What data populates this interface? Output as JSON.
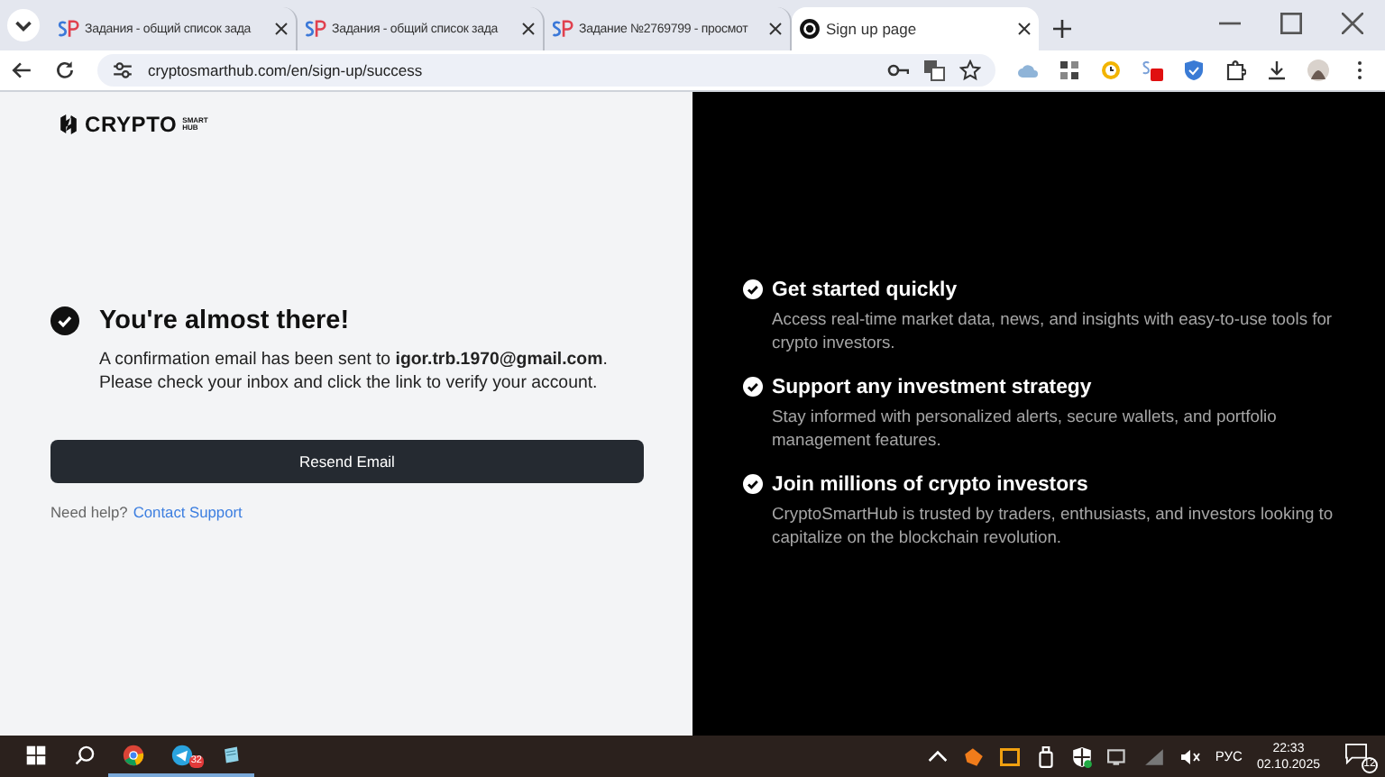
{
  "tabs": [
    {
      "title": "Задания - общий список зада",
      "kind": "task",
      "selected": false
    },
    {
      "title": "Задания - общий список зада",
      "kind": "task",
      "selected": false
    },
    {
      "title": "Задание №2769799 - просмот",
      "kind": "task",
      "selected": false
    },
    {
      "title": "Sign up page",
      "kind": "page",
      "selected": true
    }
  ],
  "address": {
    "url": "cryptosmarthub.com/en/sign-up/success"
  },
  "logo": {
    "word": "CRYPTO",
    "top": "SMART",
    "bottom": "HUB"
  },
  "confirmation": {
    "heading": "You're almost there!",
    "message": "A confirmation email has been sent to **igor.trb.1970@gmail.com**.\nPlease check your inbox and click the link to verify your account.",
    "button": "Resend Email",
    "help": "Need help?",
    "link": "Contact Support"
  },
  "features": [
    {
      "title": "Get started quickly",
      "text": "Access real-time market data, news, and insights with easy-to-use tools for crypto investors."
    },
    {
      "title": "Support any investment strategy",
      "text": "Stay informed with personalized alerts, secure wallets, and portfolio management features."
    },
    {
      "title": "Join millions of crypto investors",
      "text": "CryptoSmartHub is trusted by traders, enthusiasts, and investors looking to capitalize on the blockchain revolution."
    }
  ],
  "taskbar": {
    "telegram_badge": "32",
    "language": "РУС",
    "time": "22:33",
    "date": "02.10.2025",
    "notifications": "12"
  }
}
